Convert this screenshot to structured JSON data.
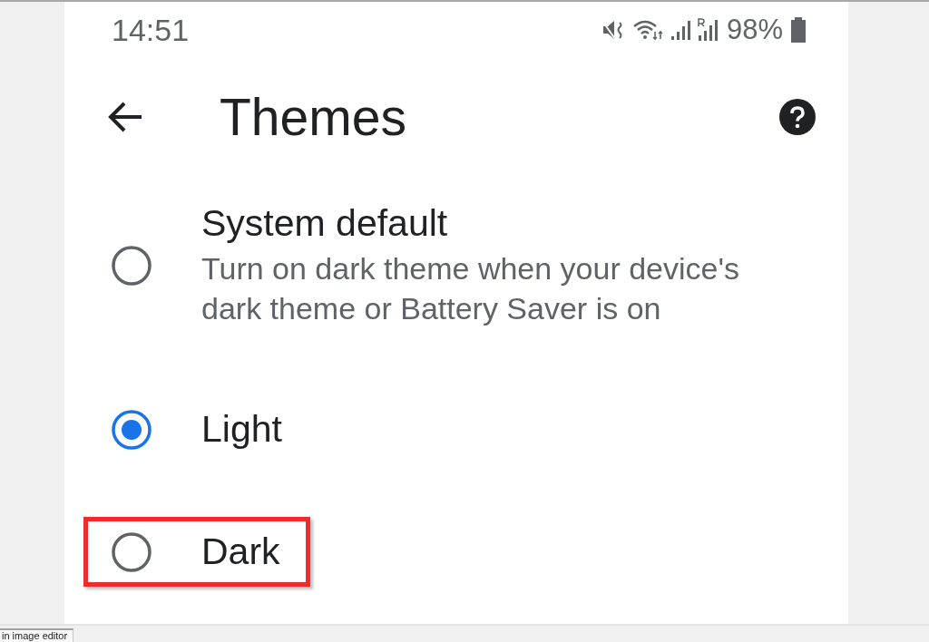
{
  "status_bar": {
    "time": "14:51",
    "battery": "98%"
  },
  "app_bar": {
    "title": "Themes"
  },
  "options": [
    {
      "title": "System default",
      "description": "Turn on dark theme when your device's dark theme or Battery Saver is on",
      "selected": false,
      "highlighted": false
    },
    {
      "title": "Light",
      "selected": true,
      "highlighted": false
    },
    {
      "title": "Dark",
      "selected": false,
      "highlighted": true
    }
  ],
  "editor_tab": {
    "label": "in image editor"
  }
}
